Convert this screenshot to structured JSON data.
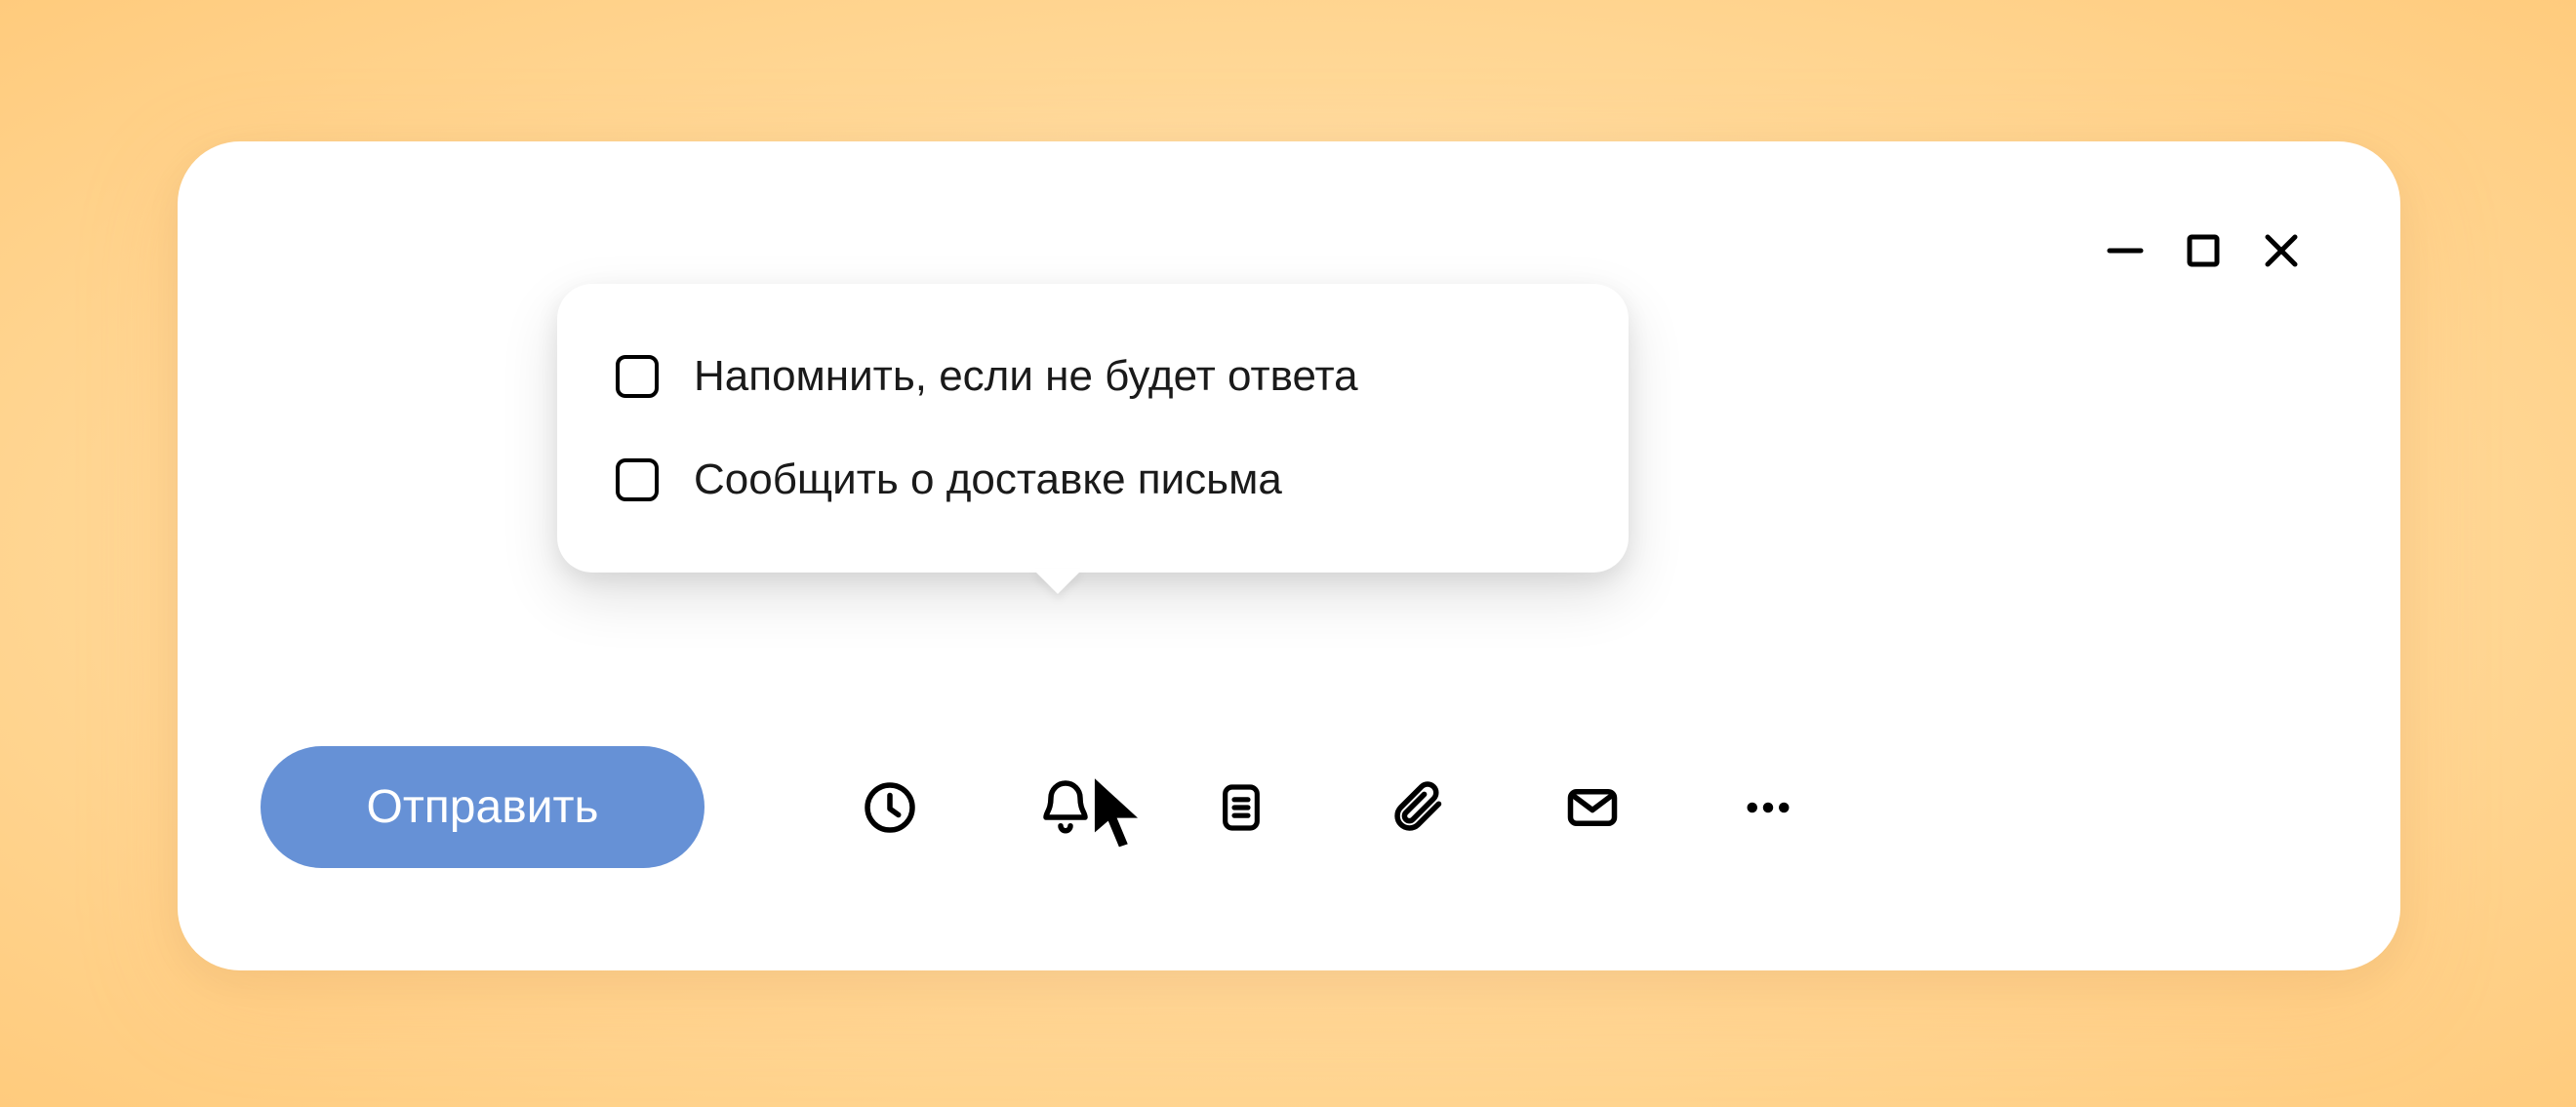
{
  "compose": {
    "send_label": "Отправить"
  },
  "popover": {
    "items": [
      {
        "label": "Напомнить, если не будет ответа",
        "checked": false
      },
      {
        "label": "Сообщить о доставке письма",
        "checked": false
      }
    ]
  }
}
